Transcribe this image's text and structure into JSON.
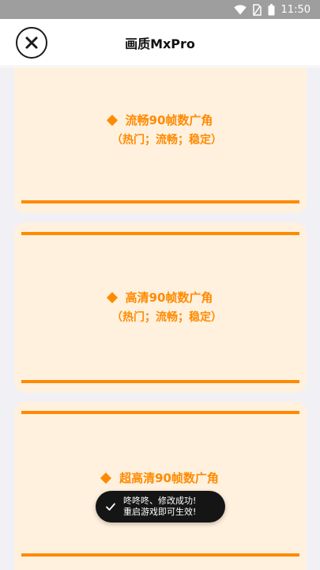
{
  "status_bar": {
    "time": "11:50",
    "icons": [
      "wifi-icon",
      "sim-no-signal-icon",
      "battery-icon"
    ]
  },
  "header": {
    "title": "画质MxPro",
    "close_icon": "close-circle-icon"
  },
  "options": [
    {
      "name": "流畅90帧数广角",
      "tags": "（热门；流畅；稳定）"
    },
    {
      "name": "高清90帧数广角",
      "tags": "（热门；流畅；稳定）"
    },
    {
      "name": "超高清90帧数广角",
      "tags": ""
    }
  ],
  "toast": {
    "message": "咚咚咚、修改成功!\n重启游戏即可生效!",
    "icon": "check-icon"
  },
  "colors": {
    "accent": "#ff8a00",
    "card_bg": "#fff1de",
    "page_bg": "#f1f1f5",
    "status_bar": "#9e9e9e",
    "toast_bg": "#151515"
  }
}
